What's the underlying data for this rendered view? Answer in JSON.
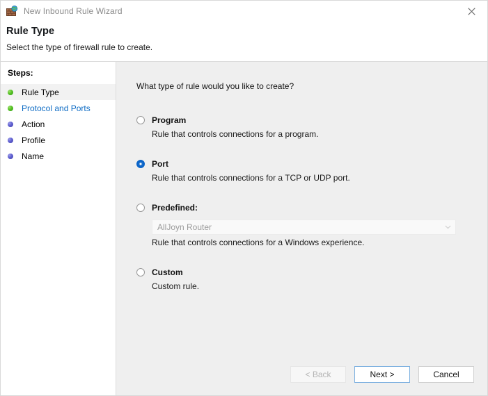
{
  "window": {
    "title": "New Inbound Rule Wizard",
    "icon": "firewall-wall-globe-icon",
    "close_label": "✕"
  },
  "header": {
    "title": "Rule Type",
    "subtitle": "Select the type of firewall rule to create."
  },
  "sidebar": {
    "heading": "Steps:",
    "items": [
      {
        "label": "Rule Type",
        "bullet": "green",
        "state": "current"
      },
      {
        "label": "Protocol and Ports",
        "bullet": "green",
        "state": "link"
      },
      {
        "label": "Action",
        "bullet": "blue",
        "state": "pending"
      },
      {
        "label": "Profile",
        "bullet": "blue",
        "state": "pending"
      },
      {
        "label": "Name",
        "bullet": "blue",
        "state": "pending"
      }
    ]
  },
  "main": {
    "question": "What type of rule would you like to create?",
    "options": [
      {
        "id": "program",
        "label": "Program",
        "description": "Rule that controls connections for a program.",
        "selected": false
      },
      {
        "id": "port",
        "label": "Port",
        "description": "Rule that controls connections for a TCP or UDP port.",
        "selected": true
      },
      {
        "id": "predefined",
        "label": "Predefined:",
        "description": "Rule that controls connections for a Windows experience.",
        "selected": false
      },
      {
        "id": "custom",
        "label": "Custom",
        "description": "Custom rule.",
        "selected": false
      }
    ],
    "predefined_combo": {
      "value": "AllJoyn Router",
      "disabled": true
    }
  },
  "footer": {
    "back_label": "< Back",
    "next_label": "Next >",
    "cancel_label": "Cancel"
  },
  "colors": {
    "accent": "#0a64c8",
    "link": "#0d6bc4",
    "panel_bg": "#efefef",
    "bullet_done": "#55c023",
    "bullet_pending": "#5f5fd0"
  }
}
